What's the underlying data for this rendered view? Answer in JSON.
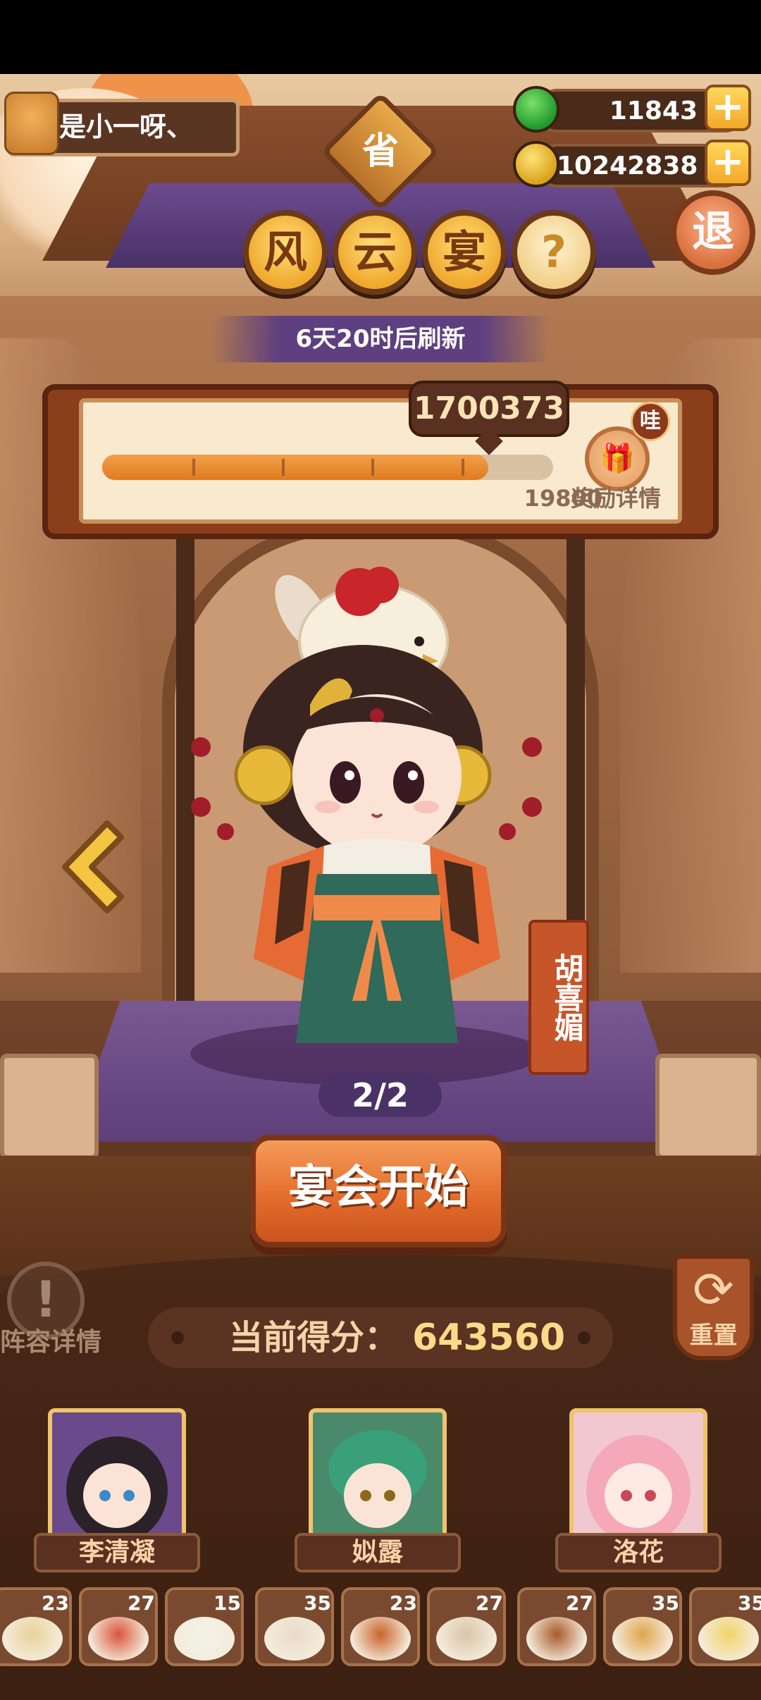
{
  "user": {
    "name": "是小一呀、"
  },
  "resources": {
    "jade": {
      "value": "11843",
      "plus": "+"
    },
    "coins": {
      "value": "10242838",
      "plus": "+"
    }
  },
  "province_badge": "省",
  "event_title": [
    "风",
    "云",
    "宴"
  ],
  "help_icon": "?",
  "exit_label": "退",
  "refresh_text": "6天20时后刷新",
  "progress": {
    "score": "1700373",
    "fraction": 0.856,
    "target": "19800",
    "reward_label": "奖励详情",
    "reward_tag": "哇"
  },
  "character": {
    "name": "胡喜媚"
  },
  "page_indicator": "2/2",
  "start_button": "宴会开始",
  "lineup_label": "阵容详情",
  "reset_label": "重置",
  "current_score": {
    "label": "当前得分：",
    "value": "643560"
  },
  "chefs": [
    {
      "name": "李清凝",
      "accent": "#6a4a8a"
    },
    {
      "name": "姒露",
      "accent": "#4a8a6a"
    },
    {
      "name": "洛花",
      "accent": "#e89aa8"
    }
  ],
  "dishes": [
    {
      "count": "23",
      "color": "#e8d29a"
    },
    {
      "count": "27",
      "color": "#d9543a"
    },
    {
      "count": "15",
      "color": "#f2f2e8"
    },
    {
      "count": "35",
      "color": "#e8dcc8"
    },
    {
      "count": "23",
      "color": "#c9632a"
    },
    {
      "count": "27",
      "color": "#d9c4a8"
    },
    {
      "count": "27",
      "color": "#a85a2a"
    },
    {
      "count": "35",
      "color": "#e0a44a"
    },
    {
      "count": "35",
      "color": "#f2d46a"
    }
  ],
  "colors": {
    "accent": "#e26a2a",
    "gold": "#f0a92e",
    "progress": "#e07a20"
  }
}
